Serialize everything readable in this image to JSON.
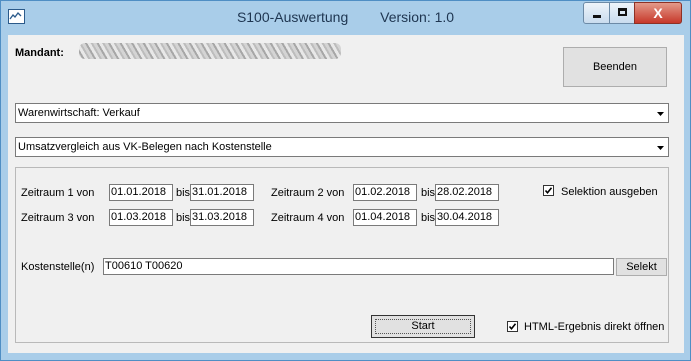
{
  "window": {
    "title": "S100-Auswertung",
    "version": "Version: 1.0",
    "minimize_glyph": "",
    "close_glyph": "X"
  },
  "mandant": {
    "label": "Mandant:"
  },
  "buttons": {
    "beenden": "Beenden",
    "selekt": "Selekt",
    "start": "Start"
  },
  "dropdowns": {
    "module": "Warenwirtschaft: Verkauf",
    "report": "Umsatzvergleich aus VK-Belegen nach Kostenstelle"
  },
  "periods": [
    {
      "label": "Zeitraum 1 von",
      "from": "01.01.2018",
      "bis": "bis",
      "to": "31.01.2018"
    },
    {
      "label": "Zeitraum 2 von",
      "from": "01.02.2018",
      "bis": "bis",
      "to": "28.02.2018"
    },
    {
      "label": "Zeitraum 3 von",
      "from": "01.03.2018",
      "bis": "bis",
      "to": "31.03.2018"
    },
    {
      "label": "Zeitraum 4 von",
      "from": "01.04.2018",
      "bis": "bis",
      "to": "30.04.2018"
    }
  ],
  "selection_output": {
    "label": "Selektion ausgeben",
    "checked": true
  },
  "kostenstelle": {
    "label": "Kostenstelle(n)",
    "value": "T00610  T00620"
  },
  "html_open": {
    "label": "HTML-Ergebnis direkt öffnen",
    "checked": true
  },
  "colors": {
    "titlebar": "#a9cde9",
    "client": "#f0f0f0",
    "close_button": "#c7382a"
  },
  "icons": {
    "app": "chart-icon",
    "dropdown": "chevron-down-icon",
    "checkbox": "check-icon"
  }
}
